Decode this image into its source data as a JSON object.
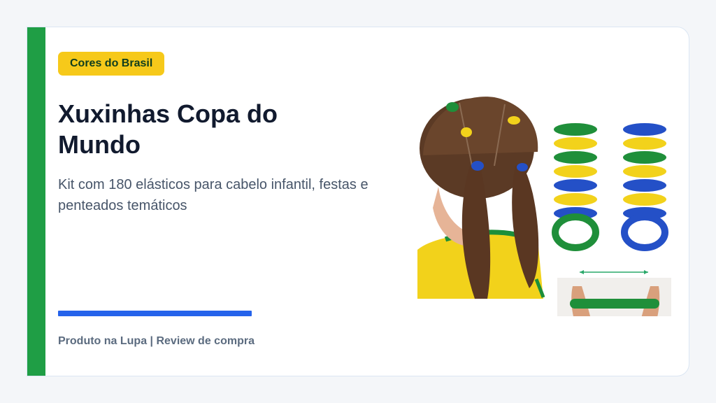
{
  "badge": {
    "label": "Cores do Brasil"
  },
  "title": "Xuxinhas Copa do Mundo",
  "subtitle": "Kit com 180 elásticos para cabelo infantil, festas e penteados temáticos",
  "footer": "Produto na Lupa | Review de compra",
  "colors": {
    "green": "#1f9e45",
    "yellow": "#f6c91a",
    "blue": "#2563eb",
    "title": "#111a2e"
  }
}
